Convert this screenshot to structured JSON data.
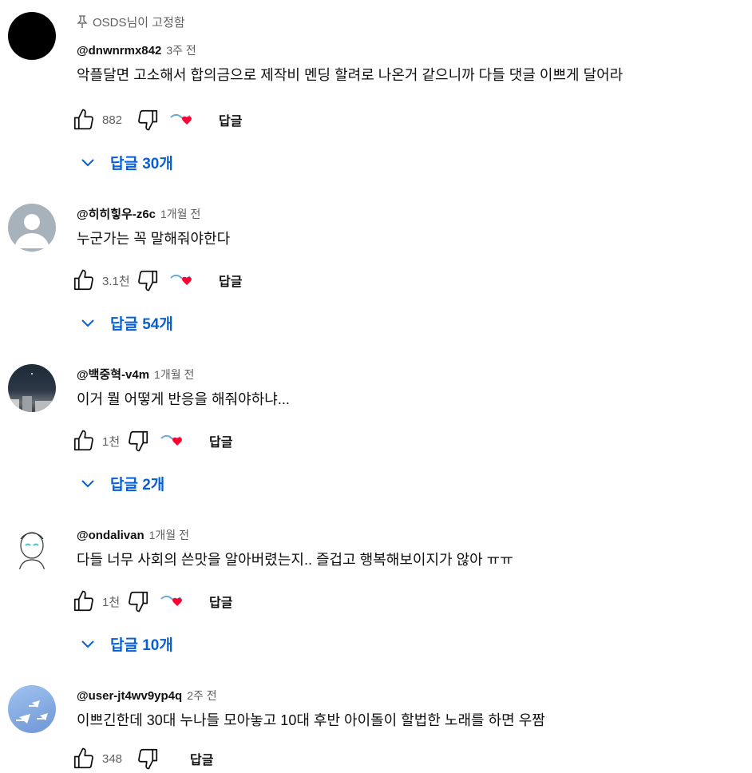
{
  "comments": [
    {
      "pinned_label": "OSDS님이 고정함",
      "author": "@dnwnrmx842",
      "time": "3주 전",
      "text": "악플달면 고소해서 합의금으로 제작비 멘딩 할려로 나온거 같으니까 다들 댓글 이쁘게 달어라",
      "likes": "882",
      "reply_label": "답글",
      "replies_label": "답글 30개"
    },
    {
      "author": "@히히힣우-z6c",
      "time": "1개월 전",
      "text": "누군가는 꼭 말해줘야한다",
      "likes": "3.1천",
      "reply_label": "답글",
      "replies_label": "답글 54개"
    },
    {
      "author": "@백중혁-v4m",
      "time": "1개월 전",
      "text": "이거 뭘 어떻게 반응을 해줘야하냐...",
      "likes": "1천",
      "reply_label": "답글",
      "replies_label": "답글 2개"
    },
    {
      "author": "@ondalivan",
      "time": "1개월 전",
      "text": "다들 너무 사회의 쓴맛을 알아버렸는지.. 즐겁고 행복해보이지가 않아 ㅠㅠ",
      "likes": "1천",
      "reply_label": "답글",
      "replies_label": "답글 10개"
    },
    {
      "author": "@user-jt4wv9yp4q",
      "time": "2주 전",
      "text": "이쁘긴한데 30대 누나들 모아놓고 10대 후반 아이돌이 할법한 노래를 하면 우짬",
      "likes": "348",
      "reply_label": "답글"
    }
  ],
  "colors": {
    "link": "#065fd4",
    "heart": "#ff0033",
    "muted": "#606060"
  }
}
